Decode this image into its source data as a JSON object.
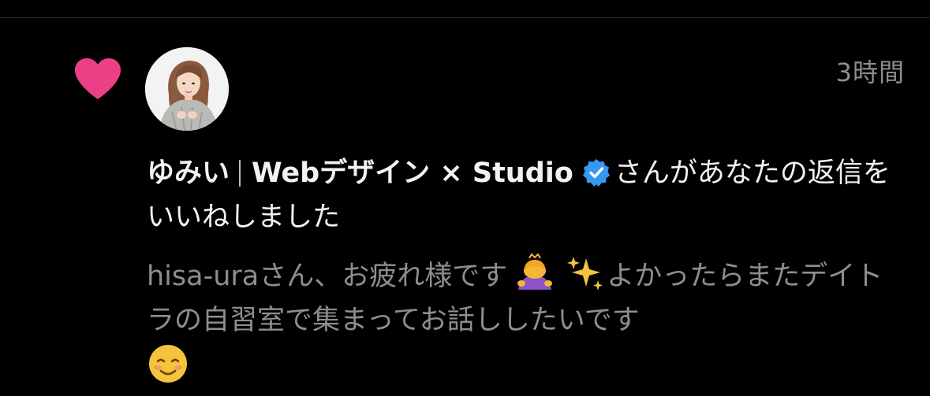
{
  "notification": {
    "timestamp": "3時間",
    "username": "ゆみい",
    "display_name_rest": "Webデザイン × Studio",
    "action_text": "さんがあなたの返信をいいねしました",
    "comment_part1": "hisa-uraさん、お疲れ様です",
    "comment_part2": "よかったらまたデイトラの自習室で集まってお話ししたいです",
    "icons": {
      "heart": "heart-icon",
      "verified": "verified-badge-icon",
      "emoji1": "person-bowing-emoji",
      "emoji2": "sparkles-emoji",
      "emoji3": "smiling-face-emoji"
    },
    "colors": {
      "heart": "#ec3f86",
      "verified": "#3897f0",
      "text_primary": "#f2f2f2",
      "text_secondary": "#8e8e8e",
      "background": "#000000"
    }
  }
}
